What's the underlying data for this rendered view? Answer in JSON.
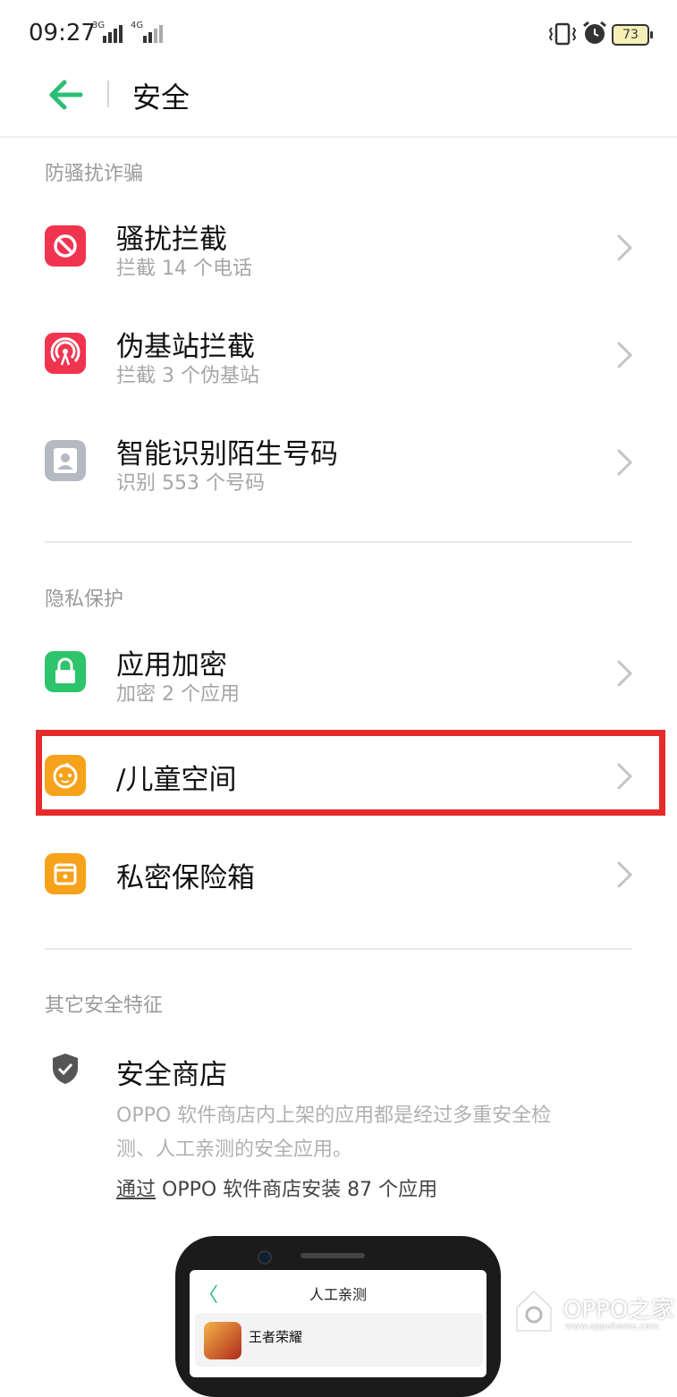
{
  "status_bar": {
    "time": "09:27",
    "net1": "3G",
    "net2": "4G",
    "battery": "73"
  },
  "header": {
    "title": "安全",
    "accent_color": "#2bbf74"
  },
  "sections": {
    "anti_harassment": {
      "label": "防骚扰诈骗",
      "items": [
        {
          "title": "骚扰拦截",
          "subtitle": "拦截 14 个电话",
          "icon": "block-icon",
          "color": "#f0344f"
        },
        {
          "title": "伪基站拦截",
          "subtitle": "拦截 3 个伪基站",
          "icon": "signal-tower-icon",
          "color": "#f0344f"
        },
        {
          "title": "智能识别陌生号码",
          "subtitle": "识别 553 个号码",
          "icon": "unknown-contact-icon",
          "color": "#b5b9c2"
        }
      ]
    },
    "privacy": {
      "label": "隐私保护",
      "items": [
        {
          "title": "应用加密",
          "subtitle": "加密 2 个应用",
          "icon": "lock-icon",
          "color": "#2ec46c"
        },
        {
          "title": "/儿童空间",
          "icon": "child-face-icon",
          "color": "#f7a21b"
        },
        {
          "title": "私密保险箱",
          "icon": "safe-box-icon",
          "color": "#f7a21b"
        }
      ]
    },
    "other": {
      "label": "其它安全特征",
      "store": {
        "title": "安全商店",
        "icon": "shield-check-icon",
        "description_line1": "OPPO 软件商店内上架的应用都是经过多重安全检",
        "description_line2": "测、人工亲测的安全应用。",
        "install_prefix": "通过",
        "install_rest": " OPPO 软件商店安装 87 个应用"
      }
    }
  },
  "highlight_color": "#e52b2b",
  "phone_preview": {
    "back": "〈",
    "title": "人工亲测",
    "app_name": "王者荣耀"
  },
  "watermark": {
    "text": "OPPO之家",
    "url": "www.oppohome.com"
  }
}
